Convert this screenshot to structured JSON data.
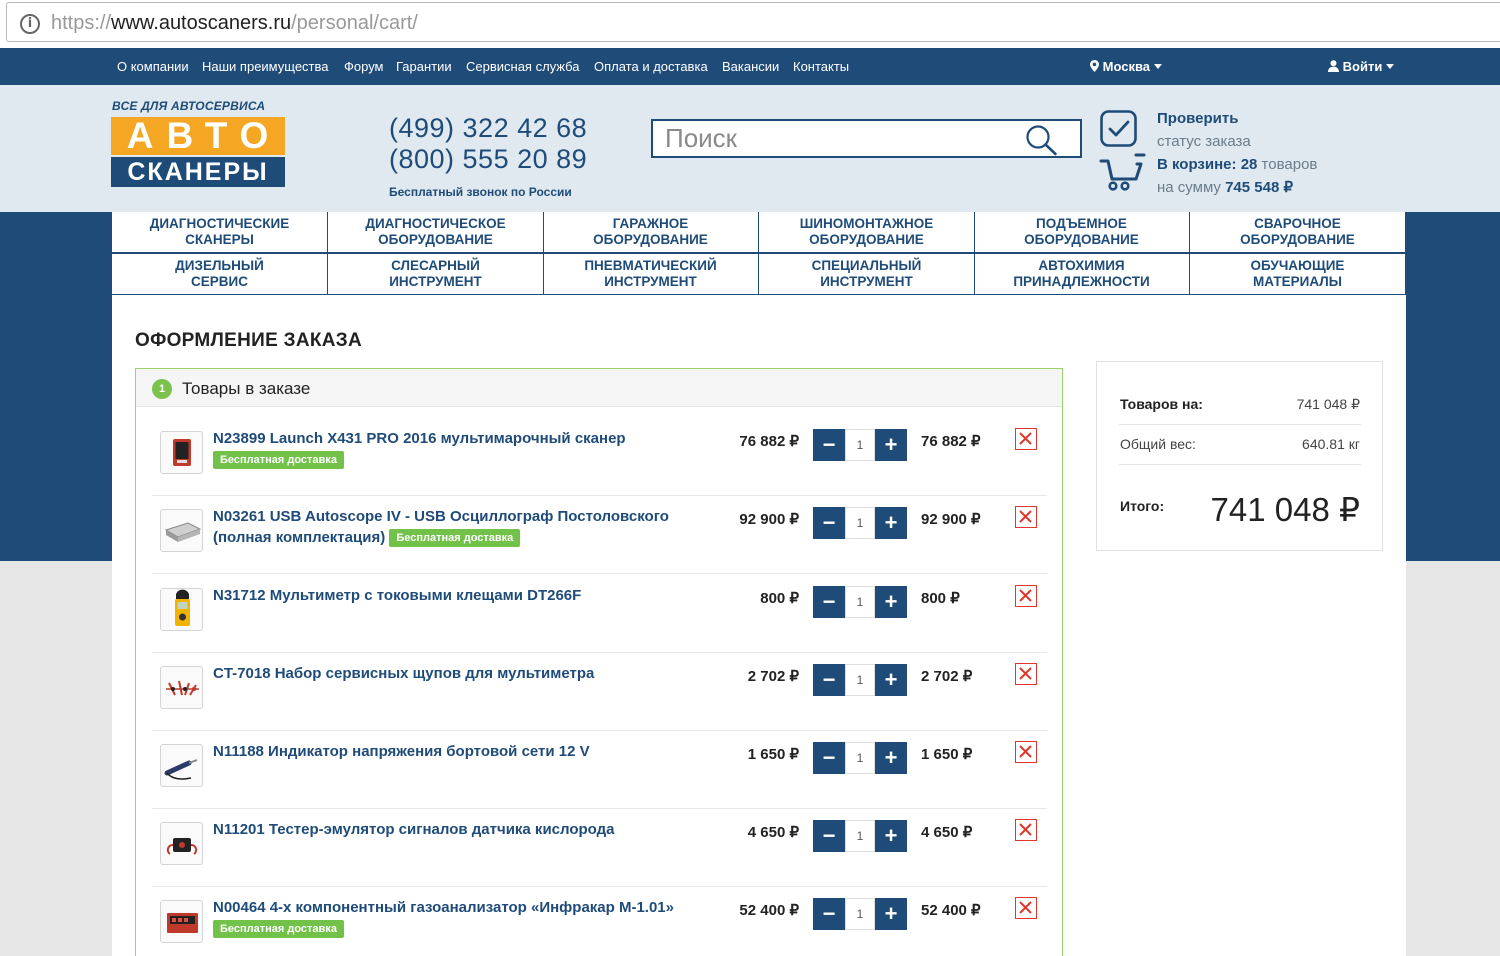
{
  "browser": {
    "url_scheme": "https://",
    "url_host": "www.autoscaners.ru",
    "url_path": "/personal/cart/"
  },
  "topnav": {
    "links": [
      "О компании",
      "Наши преимущества",
      "Форум",
      "Гарантии",
      "Сервисная служба",
      "Оплата и доставка",
      "Вакансии",
      "Контакты"
    ],
    "city": "Москва",
    "login": "Войти"
  },
  "header": {
    "logo_tagline": "ВСЕ ДЛЯ АВТОСЕРВИСА",
    "logo_top": "АВТО",
    "logo_bottom": "СКАНЕРЫ",
    "phone1": "(499) 322 42 68",
    "phone2": "(800) 555 20 89",
    "free_call": "Бесплатный звонок по России",
    "search_placeholder": "Поиск",
    "check_title": "Проверить",
    "check_sub": "статус заказа",
    "cart_label": "В корзине:",
    "cart_count": "28",
    "cart_count_unit": "товаров",
    "cart_sum_label": "на сумму",
    "cart_sum": "745 548 ₽"
  },
  "categories": [
    "ДИАГНОСТИЧЕСКИЕ\nСКАНЕРЫ",
    "ДИАГНОСТИЧЕСКОЕ\nОБОРУДОВАНИЕ",
    "ГАРАЖНОЕ\nОБОРУДОВАНИЕ",
    "ШИНОМОНТАЖНОЕ\nОБОРУДОВАНИЕ",
    "ПОДЪЕМНОЕ\nОБОРУДОВАНИЕ",
    "СВАРОЧНОЕ\nОБОРУДОВАНИЕ",
    "ДИЗЕЛЬНЫЙ\nСЕРВИС",
    "СЛЕСАРНЫЙ\nИНСТРУМЕНТ",
    "ПНЕВМАТИЧЕСКИЙ\nИНСТРУМЕНТ",
    "СПЕЦИАЛЬНЫЙ\nИНСТРУМЕНТ",
    "АВТОХИМИЯ\nПРИНАДЛЕЖНОСТИ",
    "ОБУЧАЮЩИЕ\nМАТЕРИАЛЫ"
  ],
  "page": {
    "title": "ОФОРМЛЕНИЕ ЗАКАЗА"
  },
  "order": {
    "step": "1",
    "section_title": "Товары в заказе",
    "badge_text": "Бесплатная доставка",
    "items": [
      {
        "name": "N23899 Launch X431 PRO 2016 мультимарочный сканер",
        "price": "76 882 ₽",
        "qty": "1",
        "sum": "76 882 ₽",
        "free": true,
        "icon": "tablet-scanner-icon"
      },
      {
        "name": "N03261 USB Autoscope IV - USB Осциллограф Постоловского (полная комплектация)",
        "price": "92 900 ₽",
        "qty": "1",
        "sum": "92 900 ₽",
        "free": true,
        "icon": "oscilloscope-box-icon"
      },
      {
        "name": "N31712 Мультиметр с токовыми клещами DT266F",
        "price": "800 ₽",
        "qty": "1",
        "sum": "800 ₽",
        "free": false,
        "icon": "clamp-meter-icon"
      },
      {
        "name": "CT-7018 Набор сервисных щупов для мультиметра",
        "price": "2 702 ₽",
        "qty": "1",
        "sum": "2 702 ₽",
        "free": false,
        "icon": "probe-set-icon"
      },
      {
        "name": "N11188 Индикатор напряжения бортовой сети 12 V",
        "price": "1 650 ₽",
        "qty": "1",
        "sum": "1 650 ₽",
        "free": false,
        "icon": "voltage-probe-icon"
      },
      {
        "name": "N11201 Тестер-эмулятор сигналов датчика кислорода",
        "price": "4 650 ₽",
        "qty": "1",
        "sum": "4 650 ₽",
        "free": false,
        "icon": "sensor-tester-icon"
      },
      {
        "name": "N00464 4-х компонентный газоанализатор «Инфракар М-1.01»",
        "price": "52 400 ₽",
        "qty": "1",
        "sum": "52 400 ₽",
        "free": true,
        "icon": "gas-analyzer-icon"
      }
    ]
  },
  "summary": {
    "goods_label": "Товаров на:",
    "goods_value": "741 048 ₽",
    "weight_label": "Общий вес:",
    "weight_value": "640.81 кг",
    "total_label": "Итого:",
    "total_value": "741 048 ₽"
  },
  "colors": {
    "brand_blue": "#1f4b79",
    "brand_orange": "#f5a623",
    "accent_green": "#72c149",
    "delete_red": "#e0362c"
  }
}
